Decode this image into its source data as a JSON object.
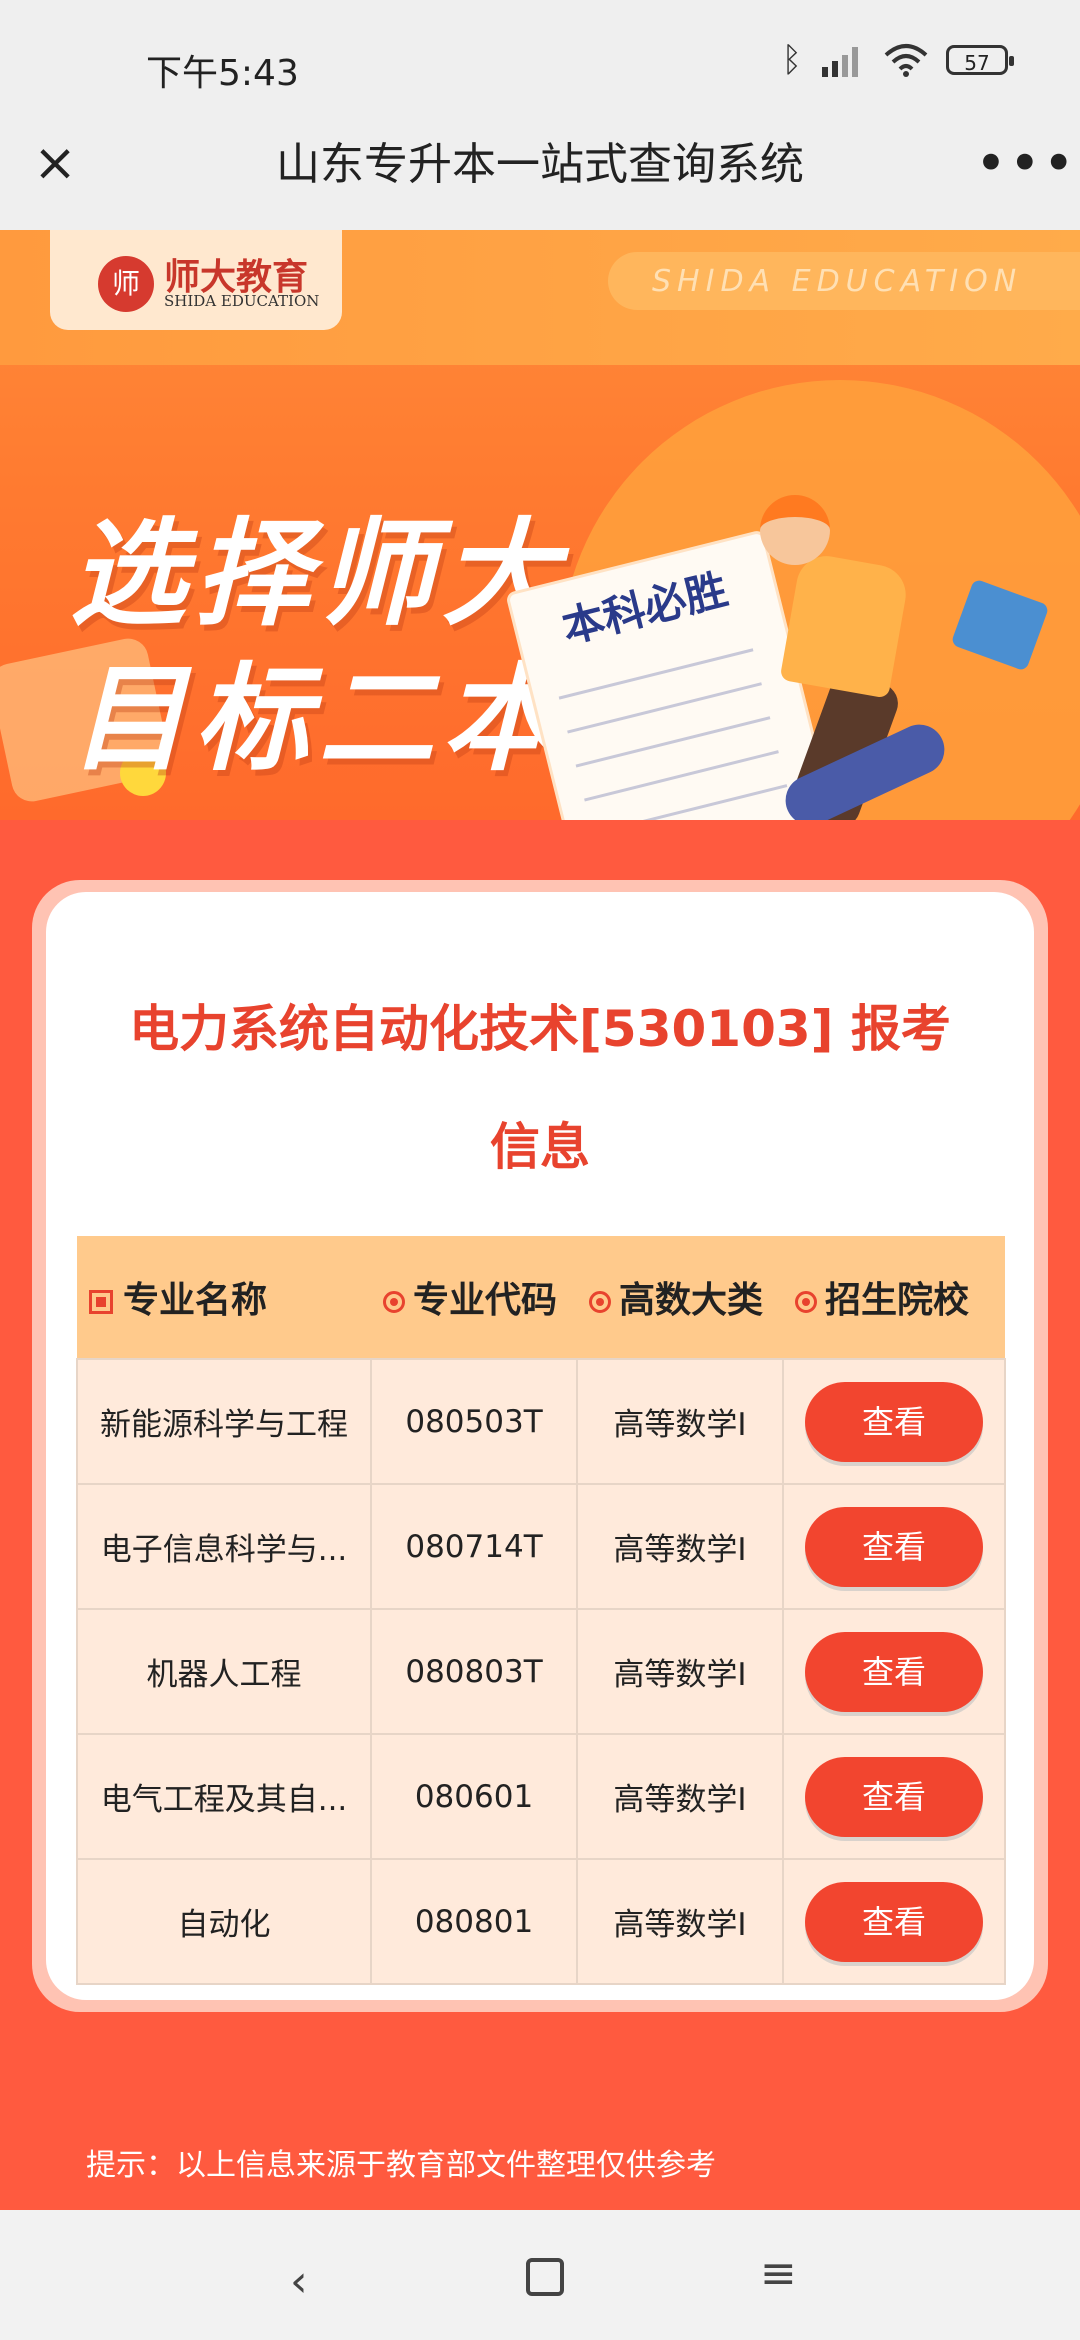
{
  "status_bar": {
    "time": "下午5:43",
    "battery": "57"
  },
  "title_bar": {
    "title": "山东专升本一站式查询系统",
    "close_glyph": "×",
    "more_glyph": "•••"
  },
  "banner": {
    "logo_text": "师大教育",
    "logo_mark": "师",
    "logo_sub": "SHIDA EDUCATION",
    "pill_text": "SHIDA EDUCATION",
    "slogan_line1": "选择师大",
    "slogan_line2": "目标二本",
    "paper_text": "本科必胜"
  },
  "card": {
    "title": "电力系统自动化技术[530103] 报考信息",
    "headers": [
      "专业名称",
      "专业代码",
      "高数大类",
      "招生院校"
    ],
    "rows": [
      {
        "name": "新能源科学与工程",
        "code": "080503T",
        "category": "高等数学I",
        "action": "查看"
      },
      {
        "name": "电子信息科学与...",
        "code": "080714T",
        "category": "高等数学I",
        "action": "查看"
      },
      {
        "name": "机器人工程",
        "code": "080803T",
        "category": "高等数学I",
        "action": "查看"
      },
      {
        "name": "电气工程及其自...",
        "code": "080601",
        "category": "高等数学I",
        "action": "查看"
      },
      {
        "name": "自动化",
        "code": "080801",
        "category": "高等数学I",
        "action": "查看"
      }
    ]
  },
  "tip": "提示：以上信息来源于教育部文件整理仅供参考",
  "nav": {
    "back_glyph": "‹",
    "menu_glyph": "≡"
  },
  "colors": {
    "page_bg": "#ff5a3f",
    "accent_red": "#e8432e",
    "header_orange": "#ffca8c",
    "row_bg": "#ffeadb",
    "button": "#f2452f"
  }
}
